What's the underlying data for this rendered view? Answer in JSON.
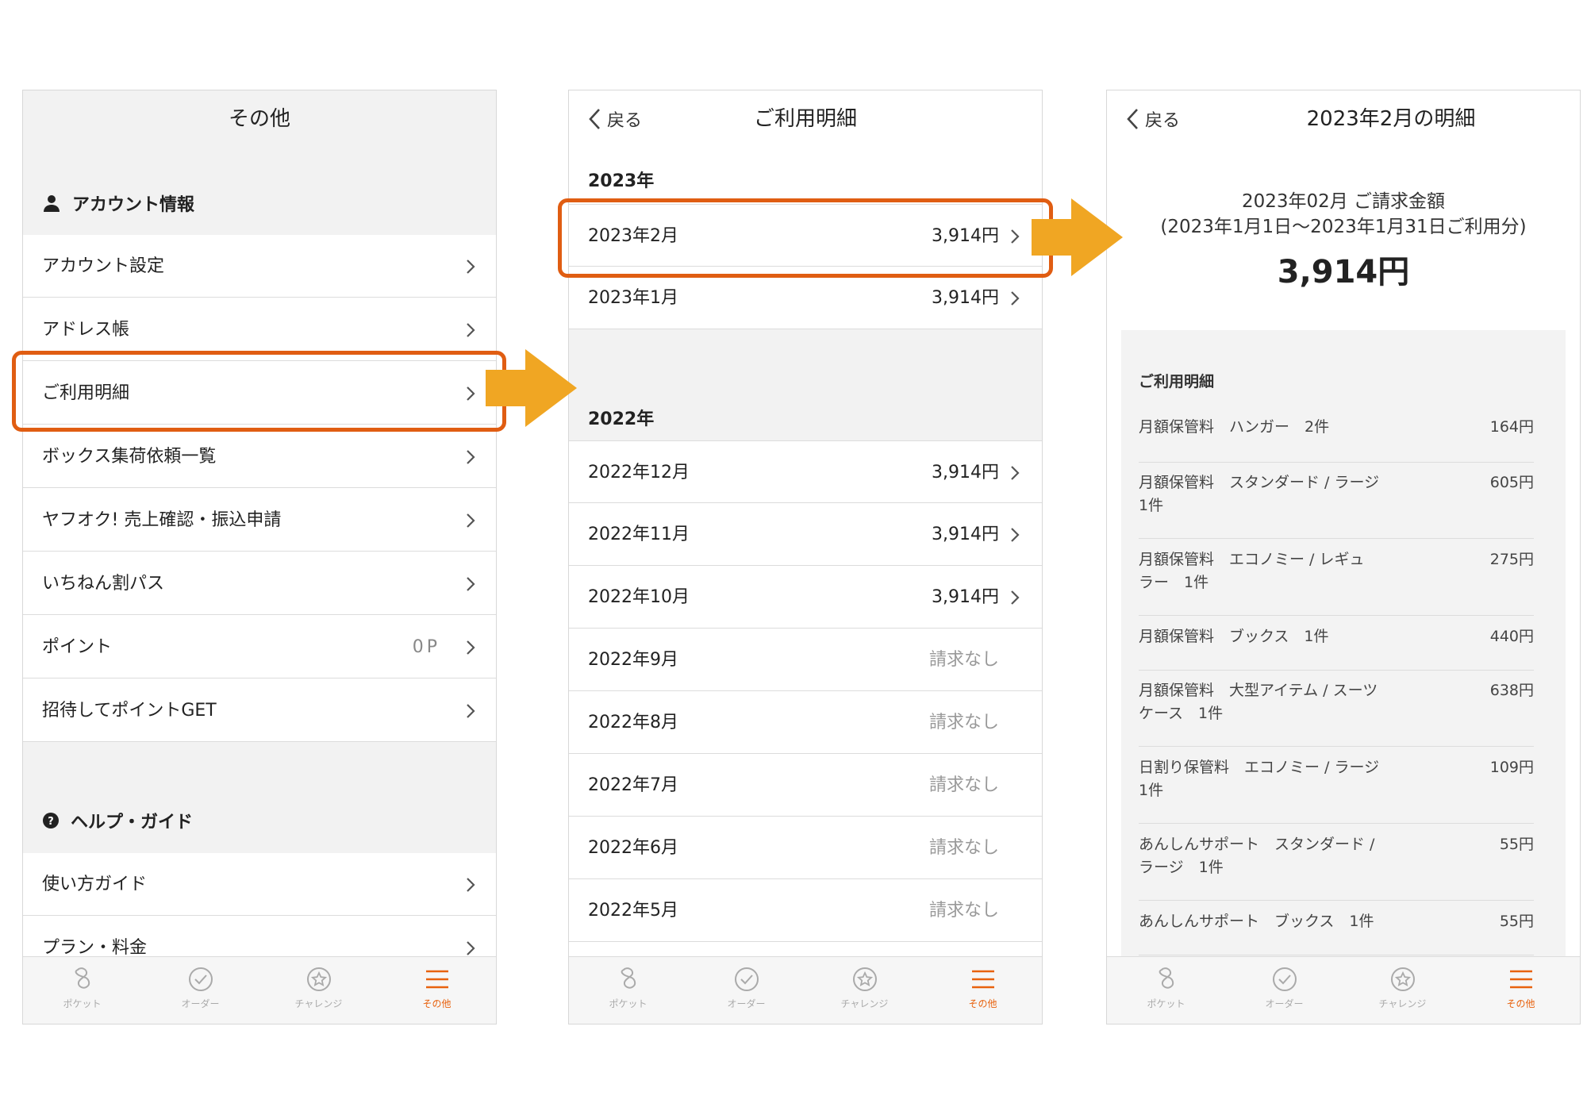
{
  "tabbar": {
    "tabs": [
      {
        "label": "ポケット",
        "icon": "pocket-icon"
      },
      {
        "label": "オーダー",
        "icon": "check-circle-icon"
      },
      {
        "label": "チャレンジ",
        "icon": "star-circle-icon"
      },
      {
        "label": "その他",
        "icon": "menu-icon"
      }
    ],
    "active_color": "#e8620e"
  },
  "screen1": {
    "title": "その他",
    "account_section": "アカウント情報",
    "account_items": [
      {
        "label": "アカウント設定"
      },
      {
        "label": "アドレス帳"
      },
      {
        "label": "ご利用明細"
      },
      {
        "label": "ボックス集荷依頼一覧"
      },
      {
        "label": "ヤフオク! 売上確認・振込申請"
      },
      {
        "label": "いちねん割パス"
      },
      {
        "label": "ポイント",
        "value": "0P"
      },
      {
        "label": "招待してポイントGET"
      }
    ],
    "help_section": "ヘルプ・ガイド",
    "help_items": [
      {
        "label": "使い方ガイド"
      },
      {
        "label": "プラン・料金"
      }
    ]
  },
  "screen2": {
    "back_label": "戻る",
    "title": "ご利用明細",
    "year_2023": "2023年",
    "rows_2023": [
      {
        "month": "2023年2月",
        "amount": "3,914円"
      },
      {
        "month": "2023年1月",
        "amount": "3,914円"
      }
    ],
    "year_2022": "2022年",
    "rows_2022": [
      {
        "month": "2022年12月",
        "amount": "3,914円"
      },
      {
        "month": "2022年11月",
        "amount": "3,914円"
      },
      {
        "month": "2022年10月",
        "amount": "3,914円"
      },
      {
        "month": "2022年9月",
        "amount": "請求なし"
      },
      {
        "month": "2022年8月",
        "amount": "請求なし"
      },
      {
        "month": "2022年7月",
        "amount": "請求なし"
      },
      {
        "month": "2022年6月",
        "amount": "請求なし"
      },
      {
        "month": "2022年5月",
        "amount": "請求なし"
      }
    ]
  },
  "screen3": {
    "back_label": "戻る",
    "title": "2023年2月の明細",
    "summary_line1": "2023年02月 ご請求金額",
    "summary_line2": "(2023年1月1日〜2023年1月31日ご利用分)",
    "total": "3,914円",
    "detail_heading": "ご利用明細",
    "items": [
      {
        "name": "月額保管料　ハンガー　2件",
        "price": "164円"
      },
      {
        "name": "月額保管料　スタンダード / ラージ\n1件",
        "price": "605円"
      },
      {
        "name": "月額保管料　エコノミー / レギュ\nラー　1件",
        "price": "275円"
      },
      {
        "name": "月額保管料　ブックス　1件",
        "price": "440円"
      },
      {
        "name": "月額保管料　大型アイテム / スーツ\nケース　1件",
        "price": "638円"
      },
      {
        "name": "日割り保管料　エコノミー / ラージ\n1件",
        "price": "109円"
      },
      {
        "name": "あんしんサポート　スタンダード /\nラージ　1件",
        "price": "55円"
      },
      {
        "name": "あんしんサポート　ブックス　1件",
        "price": "55円"
      }
    ]
  },
  "annotation": {
    "highlight_color": "#e05d12",
    "arrow_color": "#f0a623"
  }
}
